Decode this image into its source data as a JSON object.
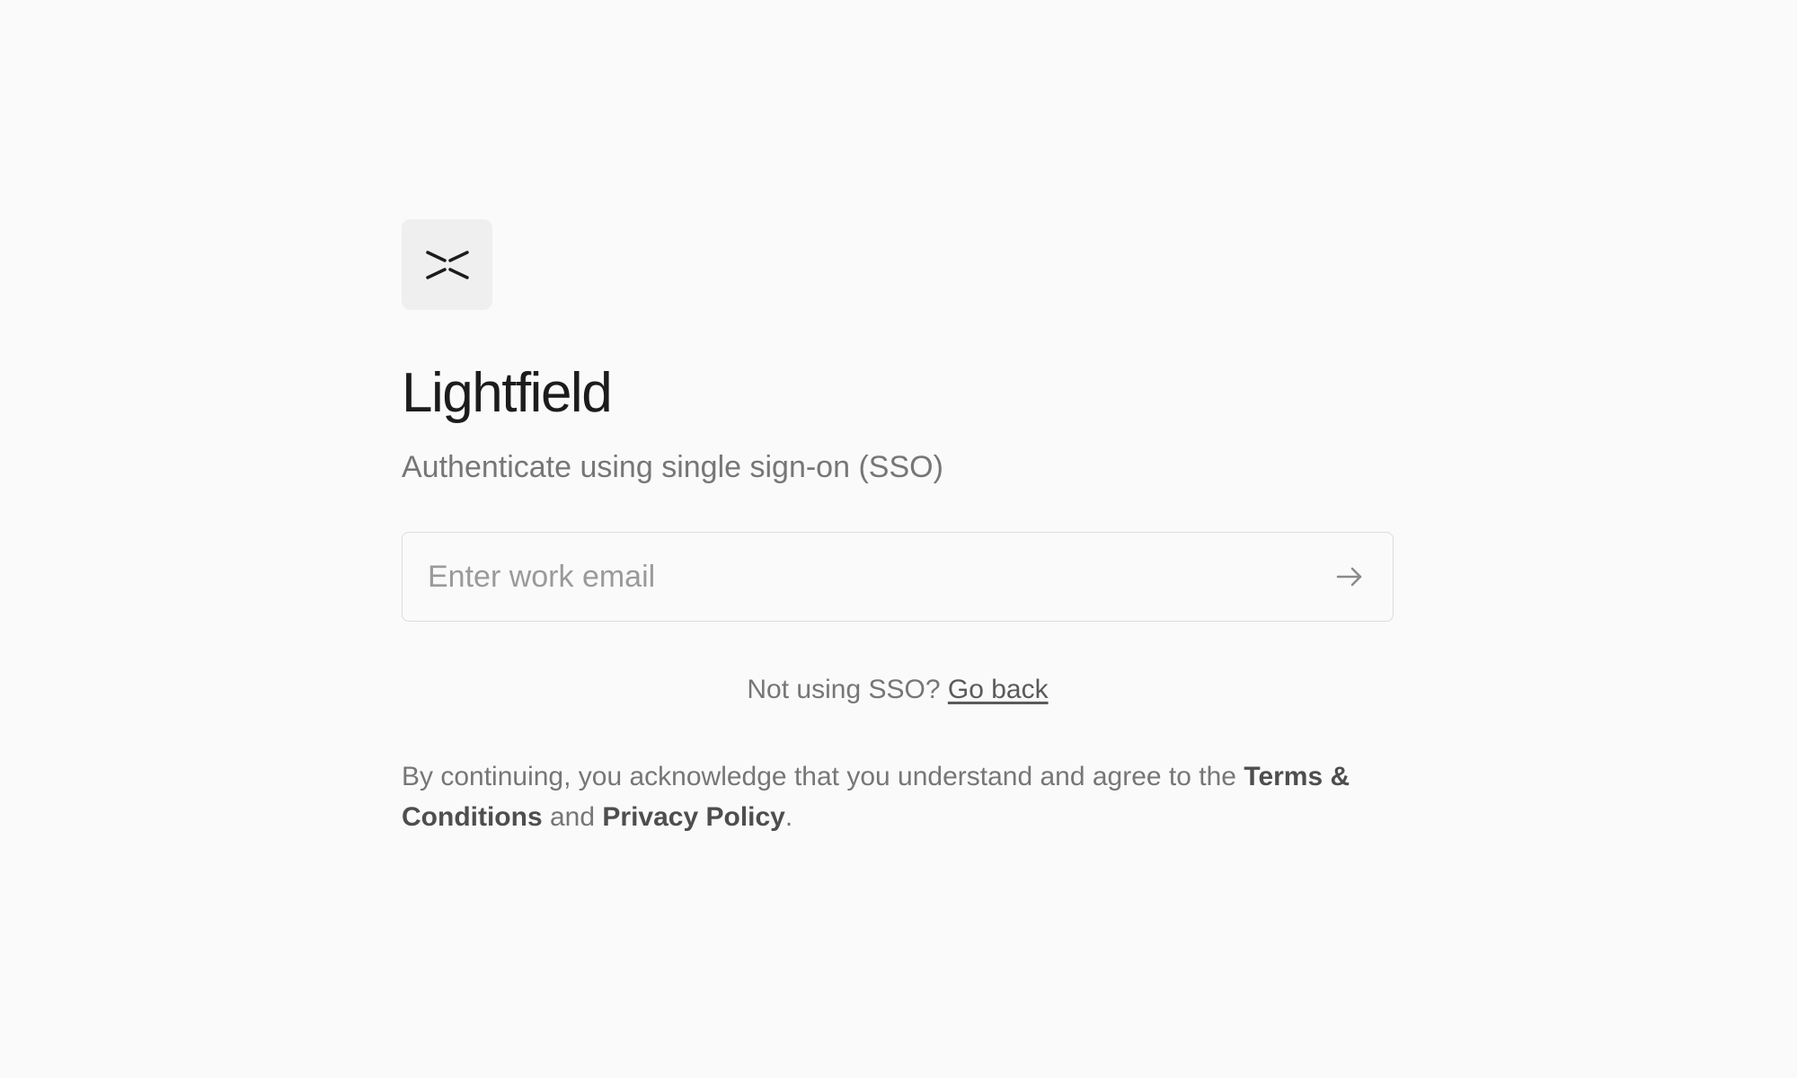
{
  "brand": {
    "logo_icon": "lightfield-logo-icon",
    "name": "Lightfield"
  },
  "auth": {
    "subtitle": "Authenticate using single sign-on (SSO)",
    "email_placeholder": "Enter work email",
    "email_value": "",
    "submit_icon": "arrow-right-icon"
  },
  "alt_login": {
    "prompt": "Not using SSO?",
    "link_label": "Go back"
  },
  "legal": {
    "prefix": "By continuing, you acknowledge that you understand and agree to the",
    "terms_label": "Terms & Conditions",
    "joiner": "and",
    "privacy_label": "Privacy Policy",
    "suffix": "."
  },
  "colors": {
    "background": "#fafafa",
    "logo_background": "#efefef",
    "heading": "#1c1c1c",
    "muted_text": "#767676",
    "input_border": "#dcdcdc",
    "placeholder": "#9a9a9a"
  }
}
